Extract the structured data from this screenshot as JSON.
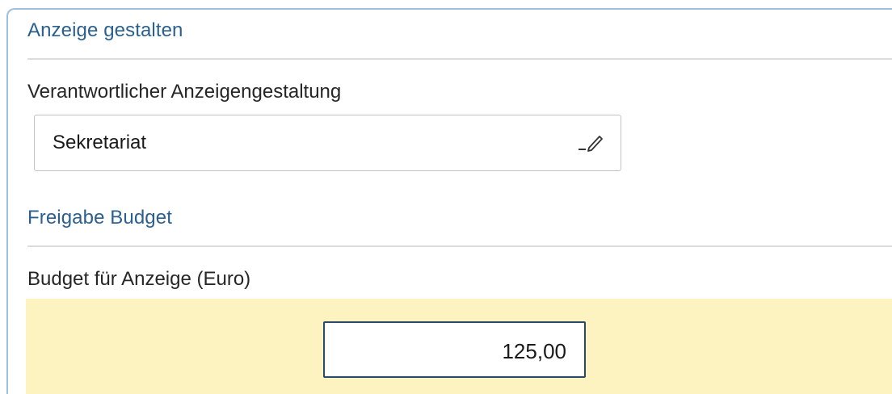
{
  "sections": {
    "design": {
      "title": "Anzeige gestalten",
      "responsible_label": "Verantwortlicher Anzeigengestaltung",
      "responsible_value": "Sekretariat",
      "edit_icon": "pencil-icon"
    },
    "budget": {
      "title": "Freigabe Budget",
      "budget_label": "Budget für Anzeige (Euro)",
      "budget_value": "125,00"
    }
  },
  "colors": {
    "section_title": "#2b5f8f",
    "highlight_background": "#fdf3c1",
    "panel_border": "#9fbedf"
  }
}
